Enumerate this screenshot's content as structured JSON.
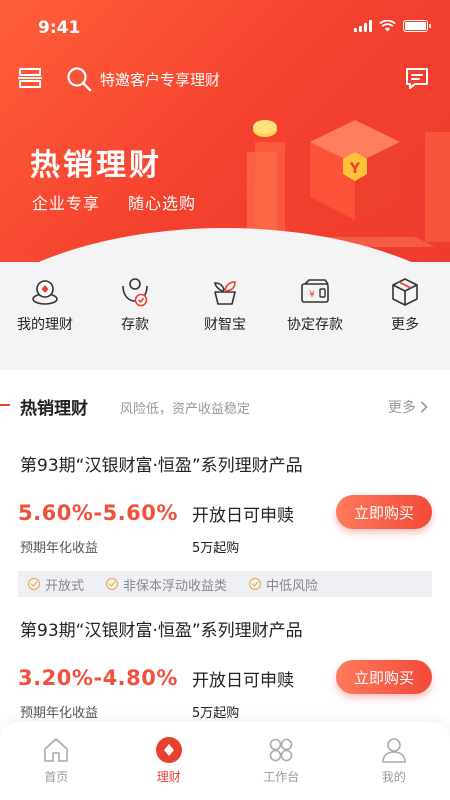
{
  "status_bar": {
    "time": "9:41"
  },
  "header": {
    "search_text": "特邀客户专享理财",
    "hero_title": "热销理财",
    "hero_subtitles": [
      "企业专享",
      "随心选购"
    ]
  },
  "quick_nav": [
    {
      "label": "我的理财",
      "icon": "my-finance-icon"
    },
    {
      "label": "存款",
      "icon": "deposit-icon"
    },
    {
      "label": "财智宝",
      "icon": "caizhibao-icon"
    },
    {
      "label": "协定存款",
      "icon": "agreement-deposit-icon"
    },
    {
      "label": "更多",
      "icon": "more-box-icon"
    }
  ],
  "section": {
    "title": "热销理财",
    "desc": "风险低，资产收益稳定",
    "more": "更多"
  },
  "products": [
    {
      "name": "第93期“汉银财富·恒盈”系列理财产品",
      "rate": "5.60%-5.60%",
      "rate_label": "预期年化收益",
      "status": "开放日可申赎",
      "min": "5万起购",
      "button": "立即购买",
      "tags": [
        "开放式",
        "非保本浮动收益类",
        "中低风险"
      ]
    },
    {
      "name": "第93期“汉银财富·恒盈”系列理财产品",
      "rate": "3.20%-4.80%",
      "rate_label": "预期年化收益",
      "status": "开放日可申赎",
      "min": "5万起购",
      "button": "立即购买"
    }
  ],
  "tabbar": [
    {
      "label": "首页",
      "icon": "home-icon",
      "active": false
    },
    {
      "label": "理财",
      "icon": "finance-icon",
      "active": true
    },
    {
      "label": "工作台",
      "icon": "workbench-icon",
      "active": false
    },
    {
      "label": "我的",
      "icon": "profile-icon",
      "active": false
    }
  ],
  "colors": {
    "brand": "#f0443a",
    "accent": "#f0503c",
    "tag_check": "#e6a83a"
  }
}
